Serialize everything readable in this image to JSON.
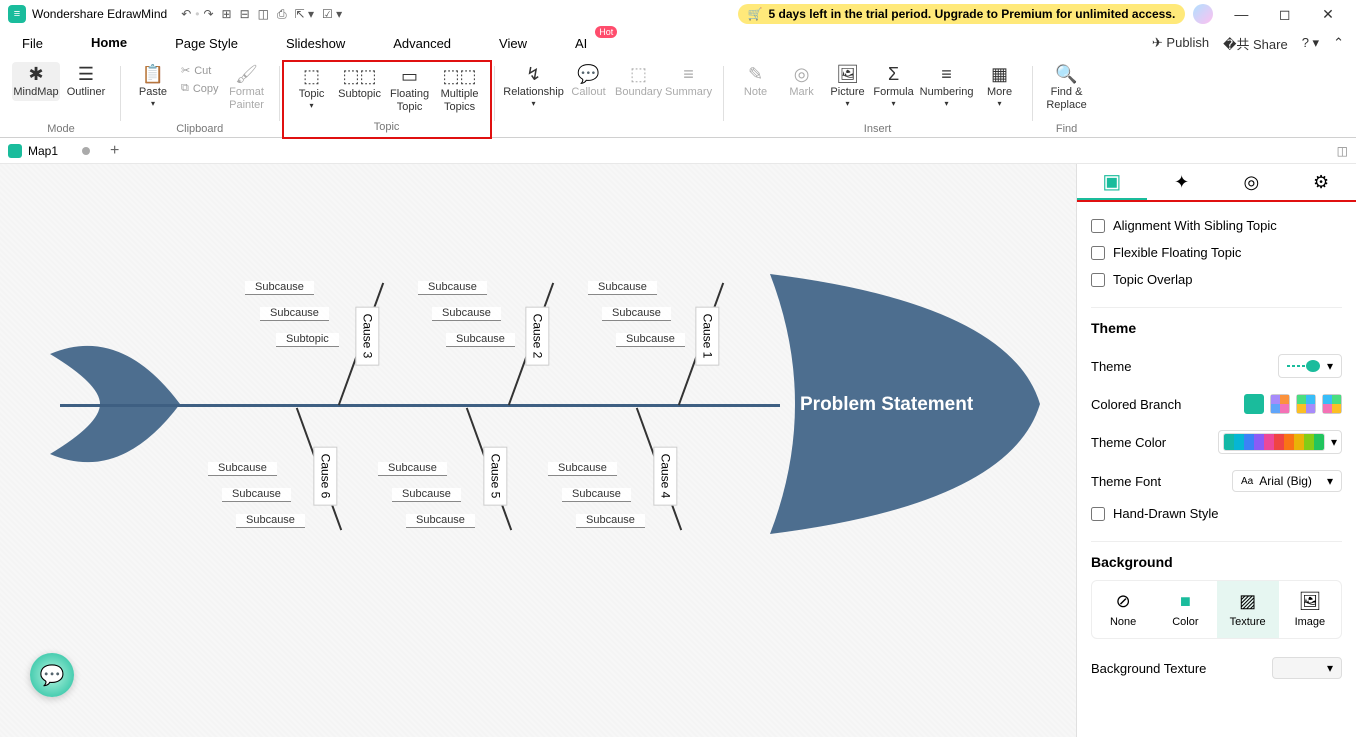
{
  "titlebar": {
    "app": "Wondershare EdrawMind",
    "trial_text": "5 days left in the trial period. Upgrade to Premium for unlimited access."
  },
  "menubar": {
    "items": [
      "File",
      "Home",
      "Page Style",
      "Slideshow",
      "Advanced",
      "View",
      "AI"
    ],
    "hot": "Hot",
    "publish": "Publish",
    "share": "Share"
  },
  "ribbon": {
    "mode": {
      "mindmap": "MindMap",
      "outliner": "Outliner",
      "label": "Mode"
    },
    "clipboard": {
      "paste": "Paste",
      "cut": "Cut",
      "copy": "Copy",
      "format": "Format Painter",
      "label": "Clipboard"
    },
    "topic_grp": {
      "topic": "Topic",
      "subtopic": "Subtopic",
      "floating": "Floating Topic",
      "multiple": "Multiple Topics",
      "label": "Topic"
    },
    "rel": "Relationship",
    "callout": "Callout",
    "boundary": "Boundary",
    "summary": "Summary",
    "insert": {
      "note": "Note",
      "mark": "Mark",
      "picture": "Picture",
      "formula": "Formula",
      "numbering": "Numbering",
      "more": "More",
      "label": "Insert"
    },
    "find": {
      "findrep": "Find & Replace",
      "label": "Find"
    }
  },
  "tabs": {
    "map": "Map1"
  },
  "fishbone": {
    "problem": "Problem Statement",
    "causes_top": [
      "Cause 3",
      "Cause 2",
      "Cause 1"
    ],
    "causes_bot": [
      "Cause 6",
      "Cause 5",
      "Cause 4"
    ],
    "top_subs": [
      [
        "Subcause",
        "Subcause",
        "Subtopic"
      ],
      [
        "Subcause",
        "Subcause",
        "Subcause"
      ],
      [
        "Subcause",
        "Subcause",
        "Subcause"
      ]
    ],
    "bot_subs": [
      [
        "Subcause",
        "Subcause",
        "Subcause"
      ],
      [
        "Subcause",
        "Subcause",
        "Subcause"
      ],
      [
        "Subcause",
        "Subcause",
        "Subcause"
      ]
    ]
  },
  "sidebar": {
    "align": "Alignment With Sibling Topic",
    "flex": "Flexible Floating Topic",
    "overlap": "Topic Overlap",
    "theme_h": "Theme",
    "theme_l": "Theme",
    "colored_branch": "Colored Branch",
    "theme_color": "Theme Color",
    "theme_font": "Theme Font",
    "font_val": "Arial (Big)",
    "hand": "Hand-Drawn Style",
    "bg_h": "Background",
    "bg_tabs": [
      "None",
      "Color",
      "Texture",
      "Image"
    ],
    "bg_texture": "Background Texture"
  }
}
